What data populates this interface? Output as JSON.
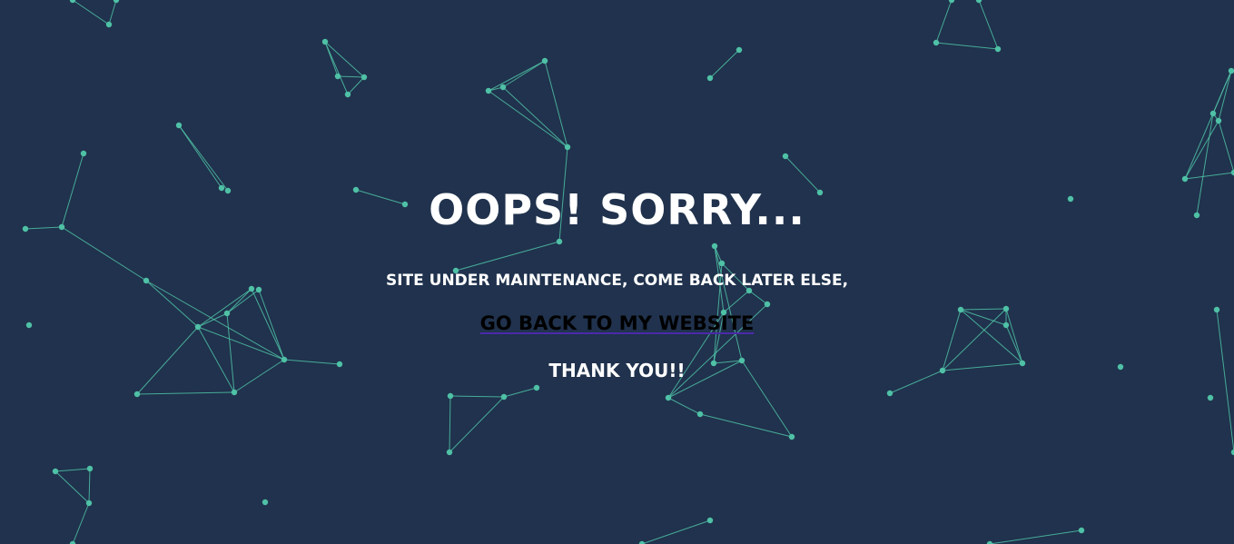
{
  "page": {
    "title": "OOPS! SORRY...",
    "subtitle": "SITE UNDER MAINTENANCE, COME BACK LATER ELSE,",
    "link_label": "GO BACK TO MY WEBSITE",
    "thanks": "THANK YOU!!"
  },
  "colors": {
    "background": "#20324d",
    "network": "#4fc1a6",
    "text": "#ffffff",
    "link": "#000000"
  }
}
